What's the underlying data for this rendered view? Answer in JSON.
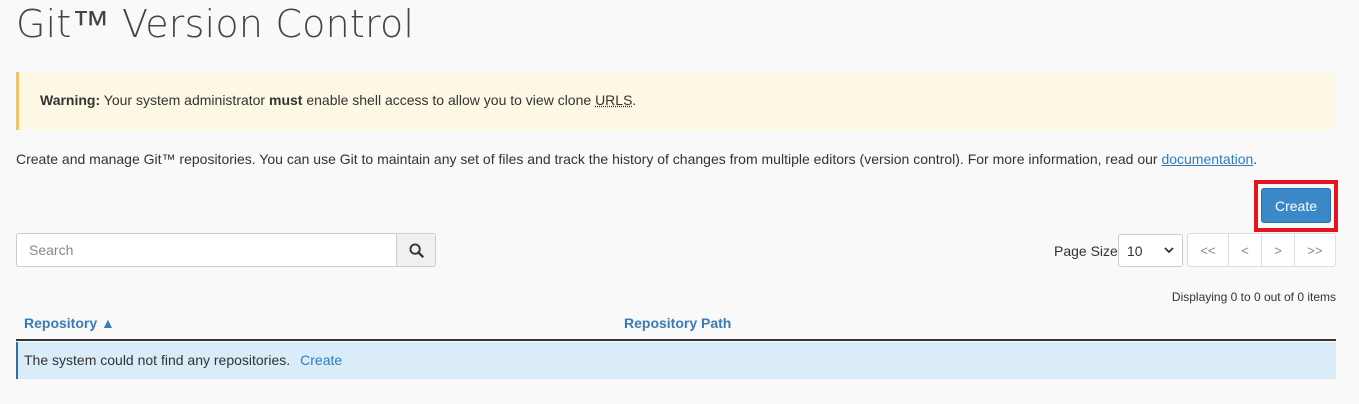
{
  "page": {
    "title": "Git™ Version Control"
  },
  "warning": {
    "label": "Warning:",
    "text_before": " Your system administrator ",
    "emphasis": "must",
    "text_after": " enable shell access to allow you to view clone ",
    "abbr": "URLS",
    "end": "."
  },
  "intro": {
    "text": "Create and manage Git™ repositories. You can use Git to maintain any set of files and track the history of changes from multiple editors (version control). For more information, read our ",
    "link": "documentation",
    "end": "."
  },
  "toolbar": {
    "create_label": "Create"
  },
  "search": {
    "placeholder": "Search",
    "icon": "search-icon"
  },
  "pagination": {
    "page_size_label": "Page Size",
    "page_size_value": "10",
    "first": "<<",
    "prev": "<",
    "next": ">",
    "last": ">>",
    "displaying": "Displaying 0 to 0 out of 0 items"
  },
  "table": {
    "columns": [
      "Repository ▲",
      "Repository Path"
    ],
    "empty_message": "The system could not find any repositories.",
    "empty_link": "Create"
  },
  "colors": {
    "accent": "#3b88c8",
    "highlight": "#e3141d",
    "warning_bg": "#fcf8e3",
    "row_bg": "#d9ecf8"
  }
}
